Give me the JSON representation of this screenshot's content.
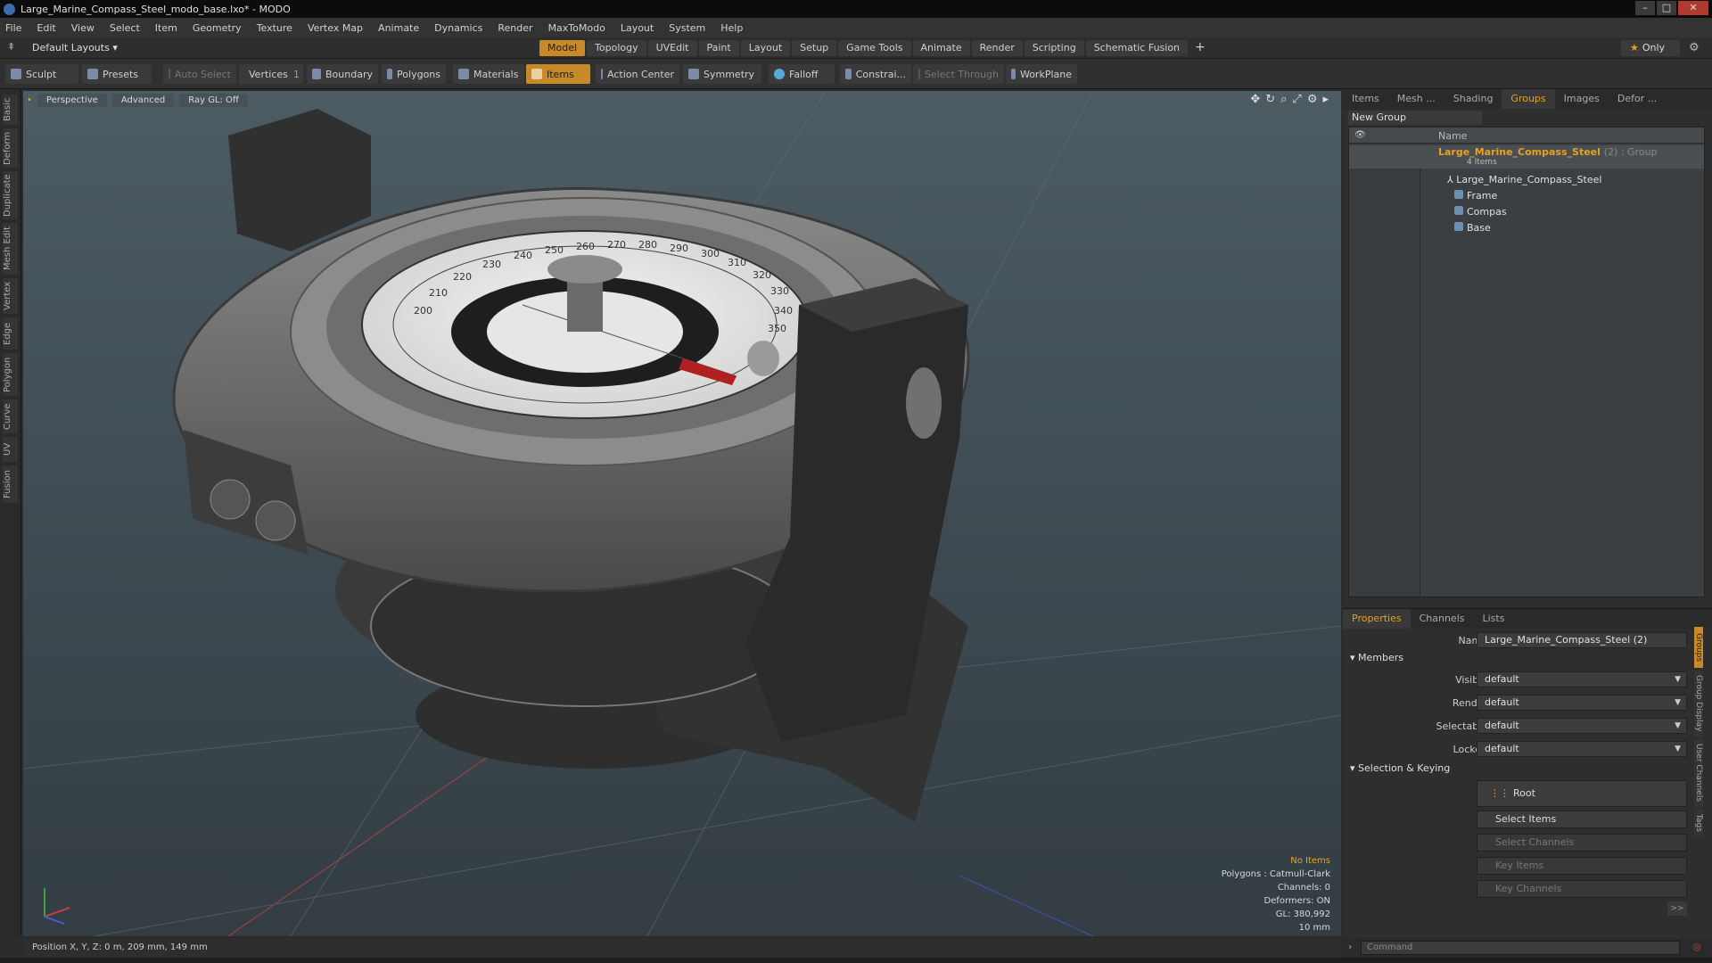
{
  "window": {
    "title": "Large_Marine_Compass_Steel_modo_base.lxo* - MODO"
  },
  "menu": [
    "File",
    "Edit",
    "View",
    "Select",
    "Item",
    "Geometry",
    "Texture",
    "Vertex Map",
    "Animate",
    "Dynamics",
    "Render",
    "MaxToModo",
    "Layout",
    "System",
    "Help"
  ],
  "layouts": {
    "label": "Default Layouts",
    "tabs": [
      "Model",
      "Topology",
      "UVEdit",
      "Paint",
      "Layout",
      "Setup",
      "Game Tools",
      "Animate",
      "Render",
      "Scripting",
      "Schematic Fusion"
    ],
    "active_tab": "Model",
    "only_label": "Only"
  },
  "toolbar": {
    "sculpt": "Sculpt",
    "presets": "Presets",
    "auto_select": "Auto Select",
    "vertices": "Vertices",
    "vertices_count": "1",
    "boundary": "Boundary",
    "polygons": "Polygons",
    "materials": "Materials",
    "items": "Items",
    "action_center": "Action Center",
    "symmetry": "Symmetry",
    "falloff": "Falloff",
    "constraints": "Constrai...",
    "select_through": "Select Through",
    "workplane": "WorkPlane"
  },
  "left_tabs": [
    "Basic",
    "Deform",
    "Duplicate",
    "Mesh Edit",
    "Vertex",
    "Edge",
    "Polygon",
    "Curve",
    "UV",
    "Fusion"
  ],
  "viewport": {
    "view": "Perspective",
    "shading": "Advanced",
    "raygl": "Ray GL: Off",
    "info": {
      "no_items": "No Items",
      "polygons": "Polygons : Catmull-Clark",
      "channels": "Channels: 0",
      "deformers": "Deformers: ON",
      "gl": "GL: 380,992",
      "grid": "10 mm"
    },
    "dial_numbers": [
      "350",
      "340",
      "330",
      "320",
      "310",
      "300",
      "290",
      "280",
      "270",
      "260",
      "250",
      "240",
      "230",
      "220",
      "210",
      "200"
    ]
  },
  "status": {
    "position": "Position X, Y, Z:  0 m, 209 mm, 149 mm"
  },
  "items_panel": {
    "tabs": [
      "Items",
      "Mesh ...",
      "Shading",
      "Groups",
      "Images",
      "Defor ..."
    ],
    "active_tab": "Groups",
    "new_group": "New Group",
    "name_header": "Name",
    "group": {
      "name": "Large_Marine_Compass_Steel",
      "tag": "(2) : Group",
      "count": "4 Items"
    },
    "children": [
      "Large_Marine_Compass_Steel",
      "Frame",
      "Compas",
      "Base"
    ]
  },
  "properties": {
    "tabs": [
      "Properties",
      "Channels",
      "Lists"
    ],
    "active_tab": "Properties",
    "name_label": "Name",
    "name_value": "Large_Marine_Compass_Steel (2)",
    "members_section": "Members",
    "fields": [
      {
        "label": "Visible",
        "value": "default"
      },
      {
        "label": "Render",
        "value": "default"
      },
      {
        "label": "Selectable",
        "value": "default"
      },
      {
        "label": "Locked",
        "value": "default"
      }
    ],
    "selection_section": "Selection & Keying",
    "root": "Root",
    "select_items": "Select Items",
    "select_channels": "Select Channels",
    "key_items": "Key Items",
    "key_channels": "Key Channels",
    "more": ">>",
    "side_tabs": [
      "Groups",
      "Group Display",
      "User Channels",
      "Tags"
    ]
  },
  "command": {
    "placeholder": "Command"
  }
}
